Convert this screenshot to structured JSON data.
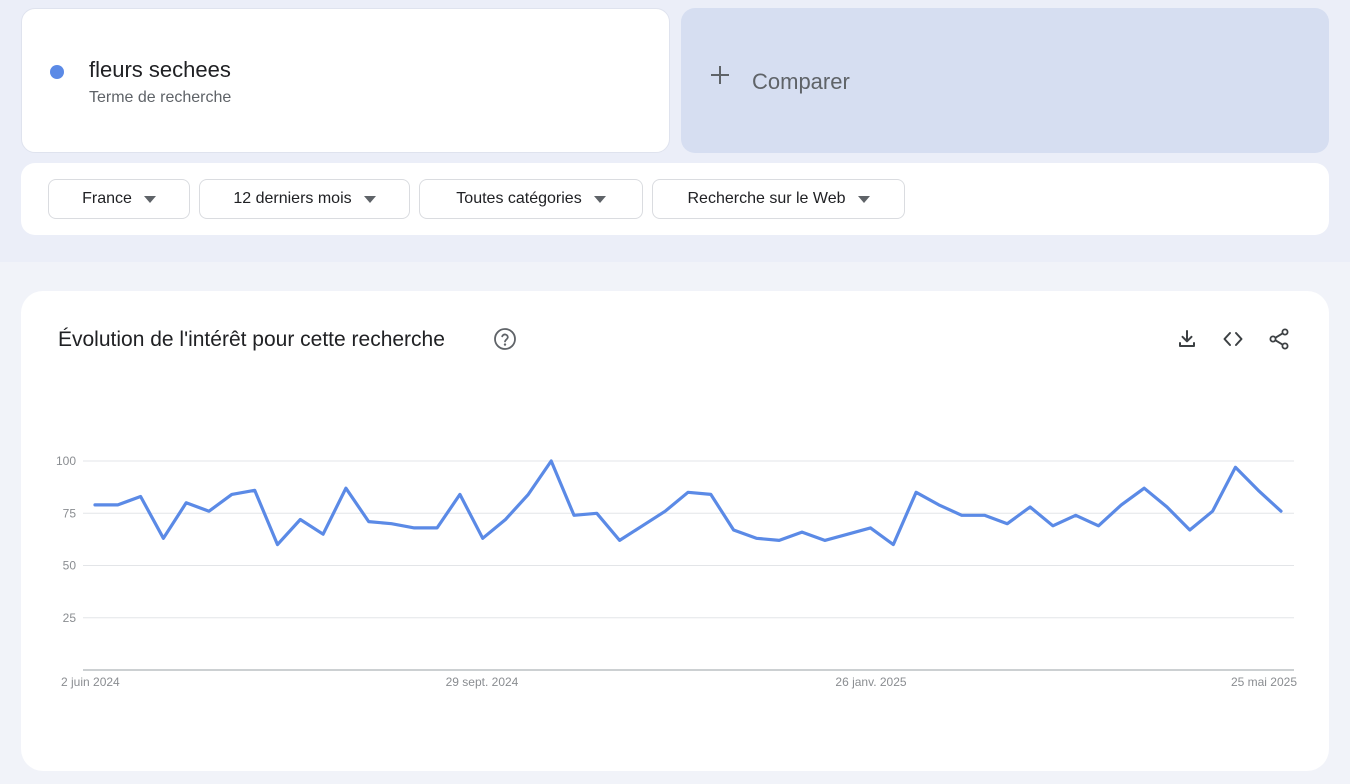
{
  "search": {
    "term": "fleurs sechees",
    "term_type": "Terme de recherche",
    "term_color": "#5b8ae6",
    "compare_label": "Comparer",
    "compare_icon": "plus-icon"
  },
  "filters": {
    "region": "France",
    "period": "12 derniers mois",
    "category": "Toutes catégories",
    "search_type": "Recherche sur le Web",
    "caret_icon": "caret-down-icon"
  },
  "chart_card": {
    "title": "Évolution de l'intérêt pour cette recherche",
    "help_icon": "help-circle-icon",
    "tools": [
      "download-icon",
      "embed-code-icon",
      "share-icon"
    ]
  },
  "chart_data": {
    "type": "line",
    "title": "Évolution de l'intérêt pour cette recherche",
    "xlabel": "",
    "ylabel": "",
    "ylim": [
      0,
      100
    ],
    "yticks": [
      25,
      50,
      75,
      100
    ],
    "x_ticks": [
      "2 juin 2024",
      "29 sept. 2024",
      "26 janv. 2025",
      "25 mai 2025"
    ],
    "grid": true,
    "series": [
      {
        "color": "#5b8ae6",
        "values": [
          79,
          79,
          83,
          63,
          80,
          76,
          84,
          86,
          60,
          72,
          65,
          87,
          71,
          70,
          68,
          68,
          84,
          63,
          72,
          84,
          100,
          74,
          75,
          62,
          69,
          76,
          85,
          84,
          67,
          63,
          62,
          66,
          62,
          65,
          68,
          60,
          85,
          79,
          74,
          74,
          70,
          78,
          69,
          74,
          69,
          79,
          87,
          78,
          67,
          76,
          97,
          86,
          76
        ]
      }
    ]
  }
}
